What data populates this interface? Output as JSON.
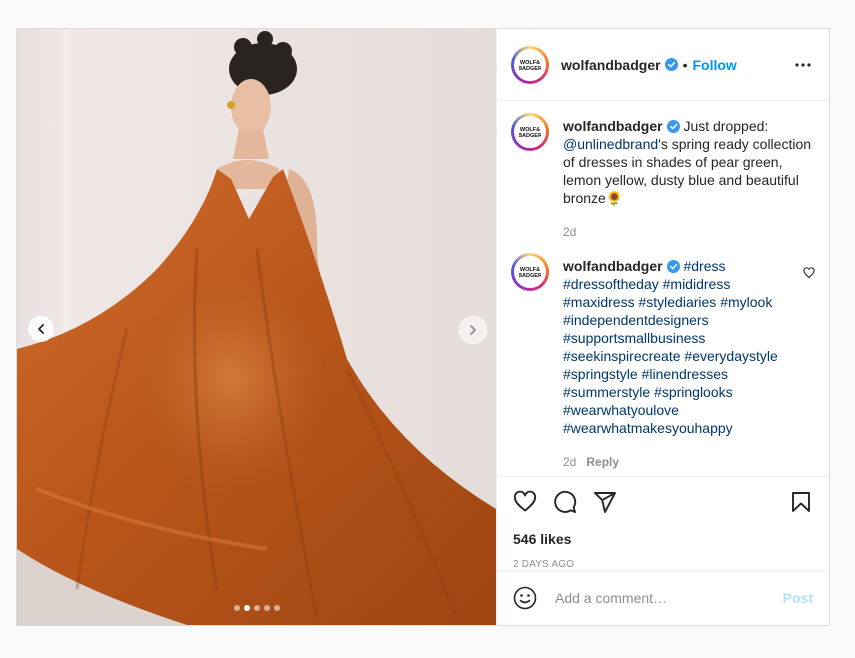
{
  "account": {
    "username": "wolfandbadger",
    "follow_label": "Follow",
    "separator": "•"
  },
  "carousel": {
    "slide_count": 5,
    "active_index": 1
  },
  "caption": {
    "username": "wolfandbadger",
    "text_1": "Just dropped: ",
    "mention": "@unlinedbrand",
    "text_2": "'s spring ready collection of dresses in shades of pear green, lemon yellow, dusty blue and beautiful bronze",
    "emoji": "🌻",
    "time": "2d"
  },
  "comment": {
    "username": "wolfandbadger",
    "hashtags": [
      "#dress",
      "#dressoftheday",
      "#mididress",
      "#maxidress",
      "#stylediaries",
      "#mylook",
      "#independentdesigners",
      "#supportsmallbusiness",
      "#seekinspirecreate",
      "#everydaystyle",
      "#springstyle",
      "#linendresses",
      "#summerstyle",
      "#springlooks",
      "#wearwhatyoulove",
      "#wearwhatmakesyouhappy"
    ],
    "time": "2d",
    "reply_label": "Reply"
  },
  "engagement": {
    "likes": "546 likes",
    "posted": "2 DAYS AGO"
  },
  "add_comment": {
    "placeholder": "Add a comment…",
    "post_label": "Post"
  },
  "colors": {
    "link_blue": "#0095f6",
    "tag_navy": "#00376b",
    "muted": "#8e8e8e",
    "dress_bronze": "#c25a1c"
  },
  "icons": {
    "like": "heart-icon",
    "comment": "comment-bubble-icon",
    "share": "paper-plane-icon",
    "save": "bookmark-icon",
    "emoji": "smiley-icon",
    "more": "more-dots-icon",
    "verified": "verified-badge-icon"
  }
}
